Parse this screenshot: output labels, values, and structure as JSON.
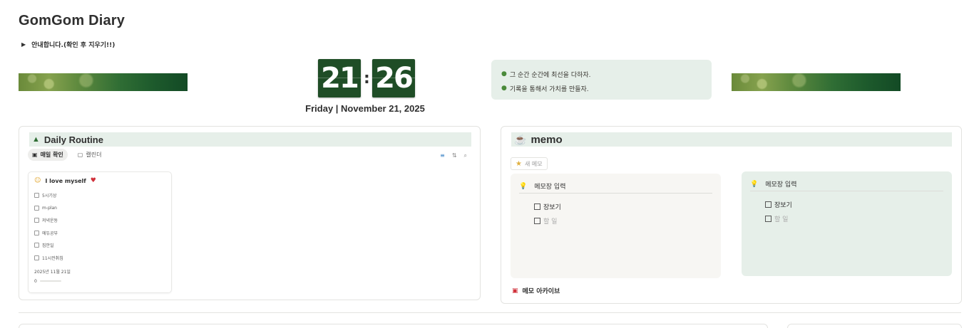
{
  "page": {
    "title": "GomGom Diary"
  },
  "notice": {
    "label": "안내합니다.(확인 후 지우기!!)",
    "toggle_icon": "triangle-right-icon"
  },
  "clock": {
    "hours": "21",
    "minutes": "26",
    "separator": ":",
    "date": "Friday | November 21, 2025"
  },
  "quote": {
    "lines": [
      "그 순간 순간에 최선을 다하자.",
      "기록을 통해서 가치를 만들자."
    ],
    "icon": "leaf-icon"
  },
  "routine": {
    "title": "Daily Routine",
    "icon": "tree-icon",
    "tabs": [
      {
        "label": "매일 확인",
        "icon": "calendar-check-icon",
        "active": true
      },
      {
        "label": "캘린더",
        "icon": "calendar-icon",
        "active": false
      }
    ],
    "tools": {
      "filter": "filter-icon",
      "sort": "sort-icon",
      "search": "search-icon"
    },
    "card": {
      "title": "I love myself",
      "items": [
        "5시기상",
        "m-plan",
        "저녁운동",
        "에듀공부",
        "집안일",
        "11시전취침"
      ],
      "date": "2025년 11월 21일",
      "progress_value": "0",
      "progress_fraction": 0
    }
  },
  "memo": {
    "title": "memo",
    "icon": "memo-icon",
    "new_button": "새 메모",
    "pads": [
      {
        "title": "메모장 입력",
        "items": [
          "장보기",
          "할 일"
        ]
      },
      {
        "title": "메모장 입력",
        "items": [
          "장보기",
          "할 일"
        ]
      }
    ],
    "archive": "메모 아카이브"
  },
  "colors": {
    "accent_green": "#1f4d26",
    "soft_green": "#e6efe9",
    "heart": "#d0303a"
  }
}
